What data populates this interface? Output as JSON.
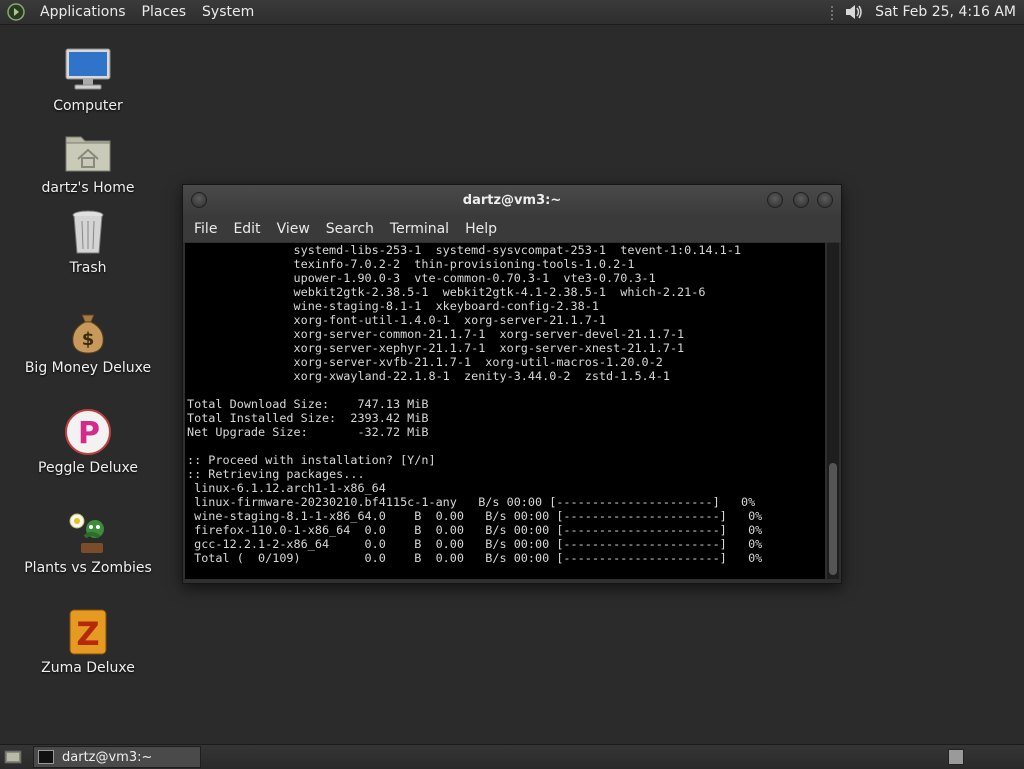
{
  "top_panel": {
    "menus": [
      "Applications",
      "Places",
      "System"
    ],
    "clock": "Sat Feb 25,  4:16 AM"
  },
  "desktop_icons": [
    {
      "label": "Computer",
      "icon": "computer-icon"
    },
    {
      "label": "dartz's Home",
      "icon": "home-folder-icon"
    },
    {
      "label": "Trash",
      "icon": "trash-icon"
    },
    {
      "label": "Big Money Deluxe",
      "icon": "money-bag-icon"
    },
    {
      "label": "Peggle Deluxe",
      "icon": "peggle-icon"
    },
    {
      "label": "Plants vs Zombies",
      "icon": "plants-icon"
    },
    {
      "label": "Zuma Deluxe",
      "icon": "zuma-icon"
    }
  ],
  "terminal": {
    "title": "dartz@vm3:~",
    "menus": [
      "File",
      "Edit",
      "View",
      "Search",
      "Terminal",
      "Help"
    ],
    "lines": [
      "               systemd-libs-253-1  systemd-sysvcompat-253-1  tevent-1:0.14.1-1",
      "               texinfo-7.0.2-2  thin-provisioning-tools-1.0.2-1",
      "               upower-1.90.0-3  vte-common-0.70.3-1  vte3-0.70.3-1",
      "               webkit2gtk-2.38.5-1  webkit2gtk-4.1-2.38.5-1  which-2.21-6",
      "               wine-staging-8.1-1  xkeyboard-config-2.38-1",
      "               xorg-font-util-1.4.0-1  xorg-server-21.1.7-1",
      "               xorg-server-common-21.1.7-1  xorg-server-devel-21.1.7-1",
      "               xorg-server-xephyr-21.1.7-1  xorg-server-xnest-21.1.7-1",
      "               xorg-server-xvfb-21.1.7-1  xorg-util-macros-1.20.0-2",
      "               xorg-xwayland-22.1.8-1  zenity-3.44.0-2  zstd-1.5.4-1",
      "",
      "Total Download Size:    747.13 MiB",
      "Total Installed Size:  2393.42 MiB",
      "Net Upgrade Size:       -32.72 MiB",
      "",
      ":: Proceed with installation? [Y/n]",
      ":: Retrieving packages...",
      " linux-6.1.12.arch1-1-x86_64",
      " linux-firmware-20230210.bf4115c-1-any   B/s 00:00 [----------------------]   0%",
      " wine-staging-8.1-1-x86_64.0    B  0.00   B/s 00:00 [----------------------]   0%",
      " firefox-110.0-1-x86_64  0.0    B  0.00   B/s 00:00 [----------------------]   0%",
      " gcc-12.2.1-2-x86_64     0.0    B  0.00   B/s 00:00 [----------------------]   0%",
      " Total (  0/109)         0.0    B  0.00   B/s 00:00 [----------------------]   0%"
    ]
  },
  "taskbar": {
    "task_label": "dartz@vm3:~"
  }
}
